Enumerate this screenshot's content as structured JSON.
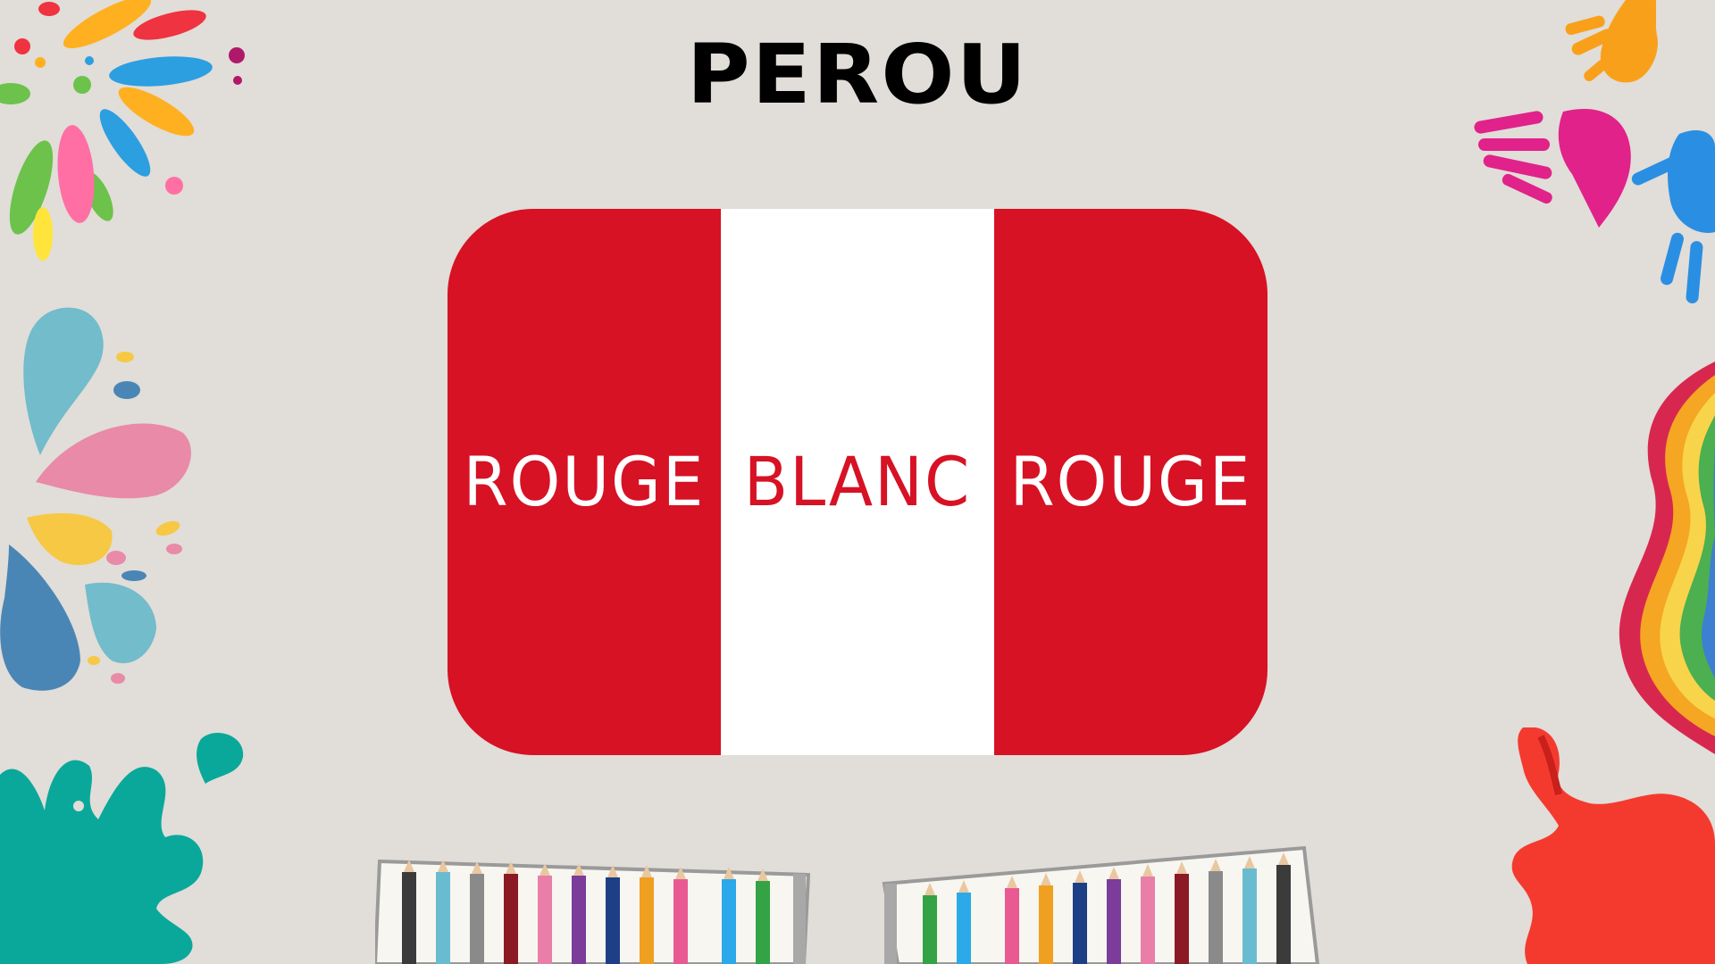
{
  "title": "PEROU",
  "flag": {
    "bands": [
      {
        "label": "ROUGE",
        "background": "#d61224",
        "text_color": "#ffffff"
      },
      {
        "label": "BLANC",
        "background": "#ffffff",
        "text_color": "#d61224"
      },
      {
        "label": "ROUGE",
        "background": "#d61224",
        "text_color": "#ffffff"
      }
    ]
  },
  "colors": {
    "background": "#e1ddd8",
    "flag_red": "#d61224",
    "flag_white": "#ffffff",
    "title": "#000000"
  },
  "decorations": [
    "paint-splash-burst-icon",
    "paint-drops-icon",
    "teal-paint-splat-icon",
    "handprints-icon",
    "rainbow-wave-icon",
    "red-paint-splat-icon",
    "colored-pencil-box-icon"
  ]
}
